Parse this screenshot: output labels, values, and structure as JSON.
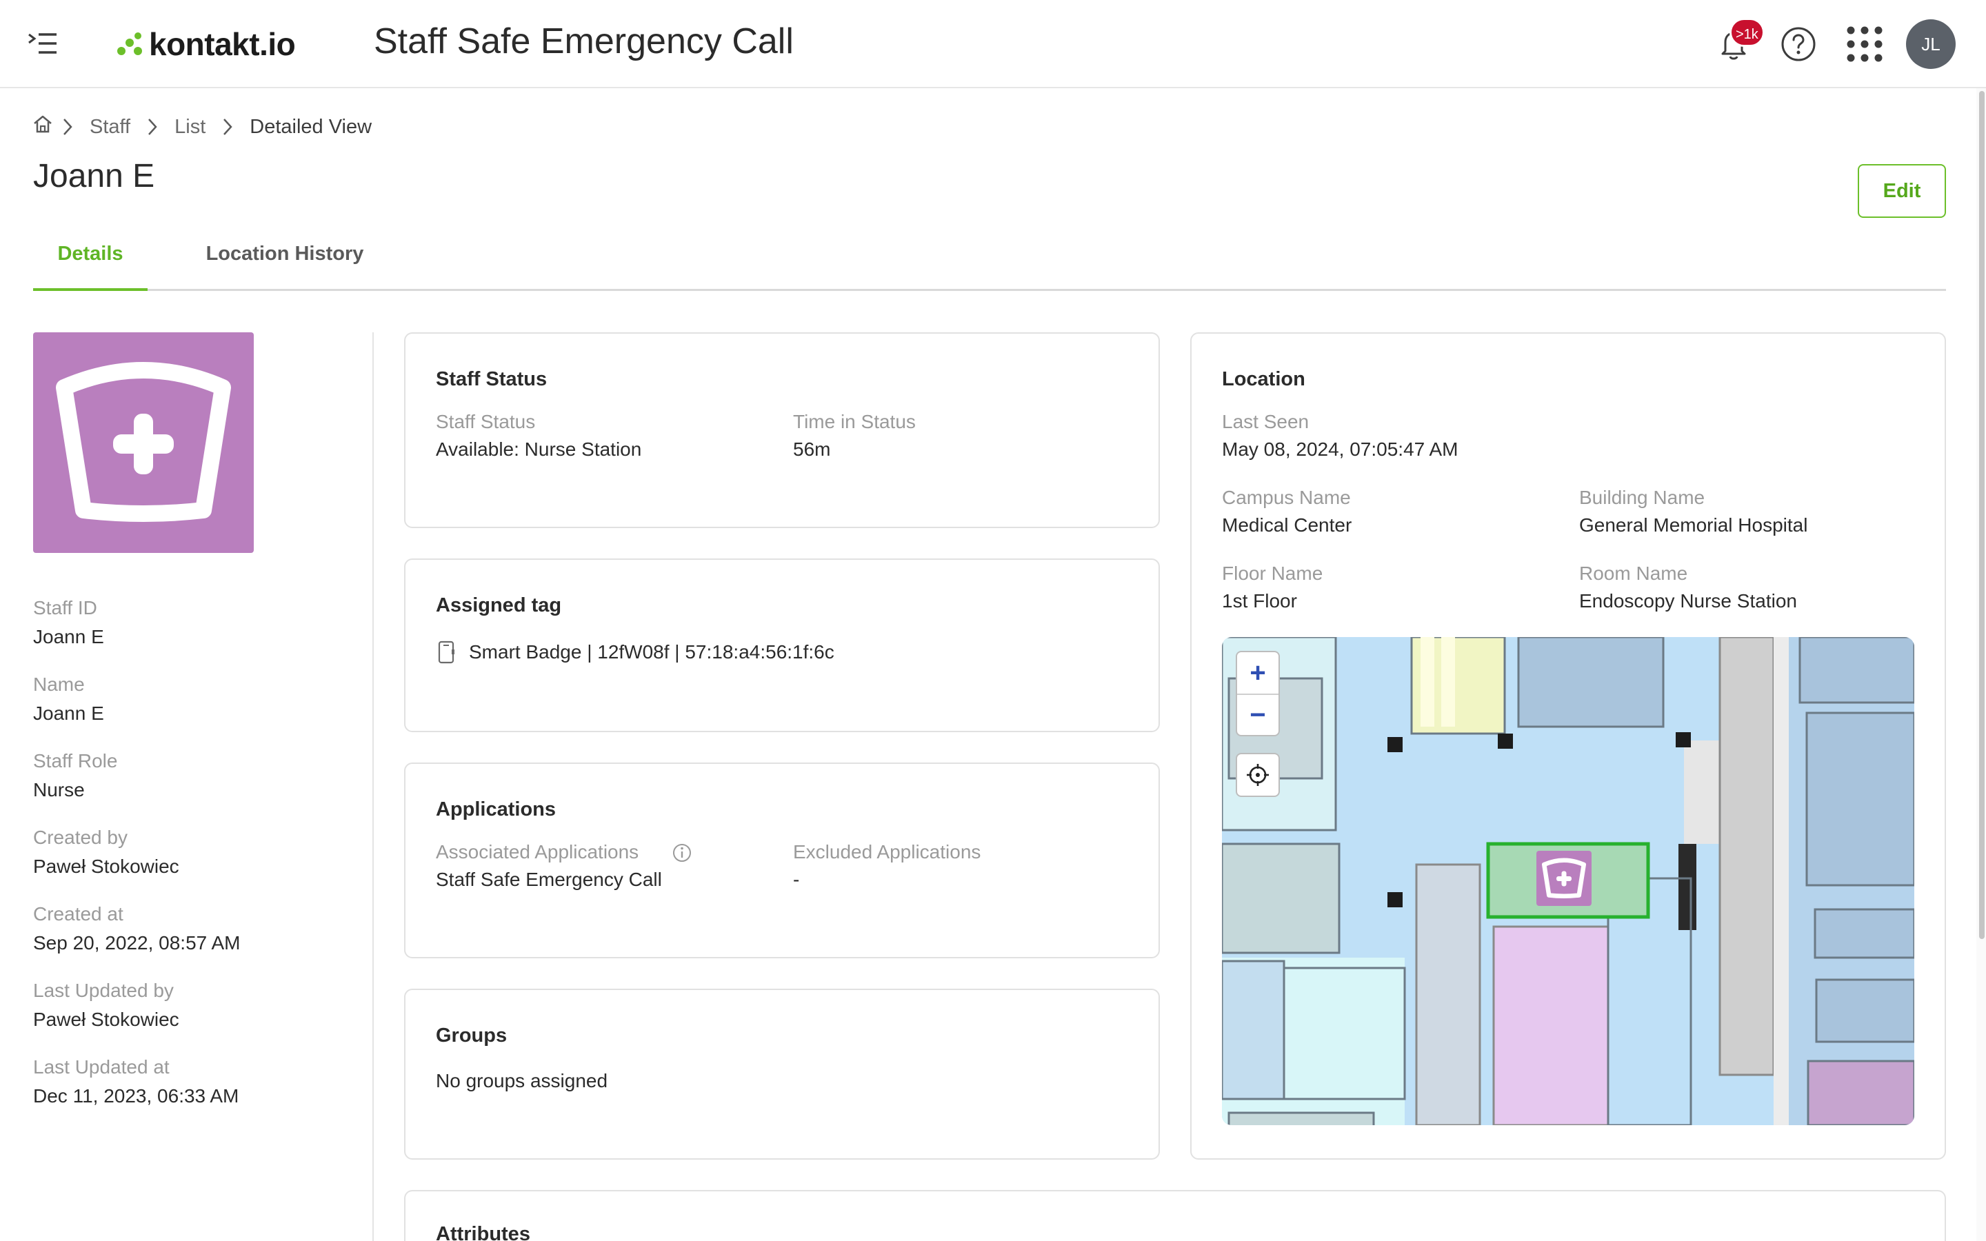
{
  "header": {
    "logo_text": "kontakt.io",
    "app_title": "Staff Safe Emergency Call",
    "notification_count": ">1k",
    "avatar_initials": "JL",
    "icons": [
      "menu-collapse-icon",
      "bell-icon",
      "help-icon",
      "apps-grid-icon"
    ]
  },
  "breadcrumb": {
    "items": [
      "Staff",
      "List",
      "Detailed View"
    ]
  },
  "page": {
    "title": "Joann E",
    "edit_label": "Edit"
  },
  "tabs": [
    {
      "label": "Details",
      "active": true
    },
    {
      "label": "Location History",
      "active": false
    }
  ],
  "profile": {
    "image_color": "#b97fbe",
    "image_icon": "nurse-cap-icon",
    "fields": [
      {
        "label": "Staff ID",
        "value": "Joann E"
      },
      {
        "label": "Name",
        "value": "Joann E"
      },
      {
        "label": "Staff Role",
        "value": "Nurse"
      },
      {
        "label": "Created by",
        "value": "Paweł Stokowiec"
      },
      {
        "label": "Created at",
        "value": "Sep 20, 2022, 08:57 AM"
      },
      {
        "label": "Last Updated by",
        "value": "Paweł Stokowiec"
      },
      {
        "label": "Last Updated at",
        "value": "Dec 11, 2023, 06:33 AM"
      }
    ]
  },
  "staff_status": {
    "title": "Staff Status",
    "status_label": "Staff Status",
    "status_value": "Available: Nurse Station",
    "time_label": "Time in Status",
    "time_value": "56m"
  },
  "assigned_tag": {
    "title": "Assigned tag",
    "value": "Smart Badge | 12fW08f | 57:18:a4:56:1f:6c"
  },
  "applications": {
    "title": "Applications",
    "associated_label": "Associated Applications",
    "associated_value": "Staff Safe Emergency Call",
    "excluded_label": "Excluded Applications",
    "excluded_value": "-"
  },
  "groups": {
    "title": "Groups",
    "value": "No groups assigned"
  },
  "attributes": {
    "title": "Attributes"
  },
  "location": {
    "title": "Location",
    "last_seen_label": "Last Seen",
    "last_seen_value": "May 08, 2024, 07:05:47 AM",
    "campus_label": "Campus Name",
    "campus_value": "Medical Center",
    "building_label": "Building Name",
    "building_value": "General Memorial Hospital",
    "floor_label": "Floor Name",
    "floor_value": "1st Floor",
    "room_label": "Room Name",
    "room_value": "Endoscopy Nurse Station",
    "map_controls": {
      "zoom_in": "+",
      "zoom_out": "−"
    }
  },
  "colors": {
    "brand_green": "#6cbf2a",
    "staff_purple": "#b97fbe",
    "notification_red": "#c8102e"
  }
}
